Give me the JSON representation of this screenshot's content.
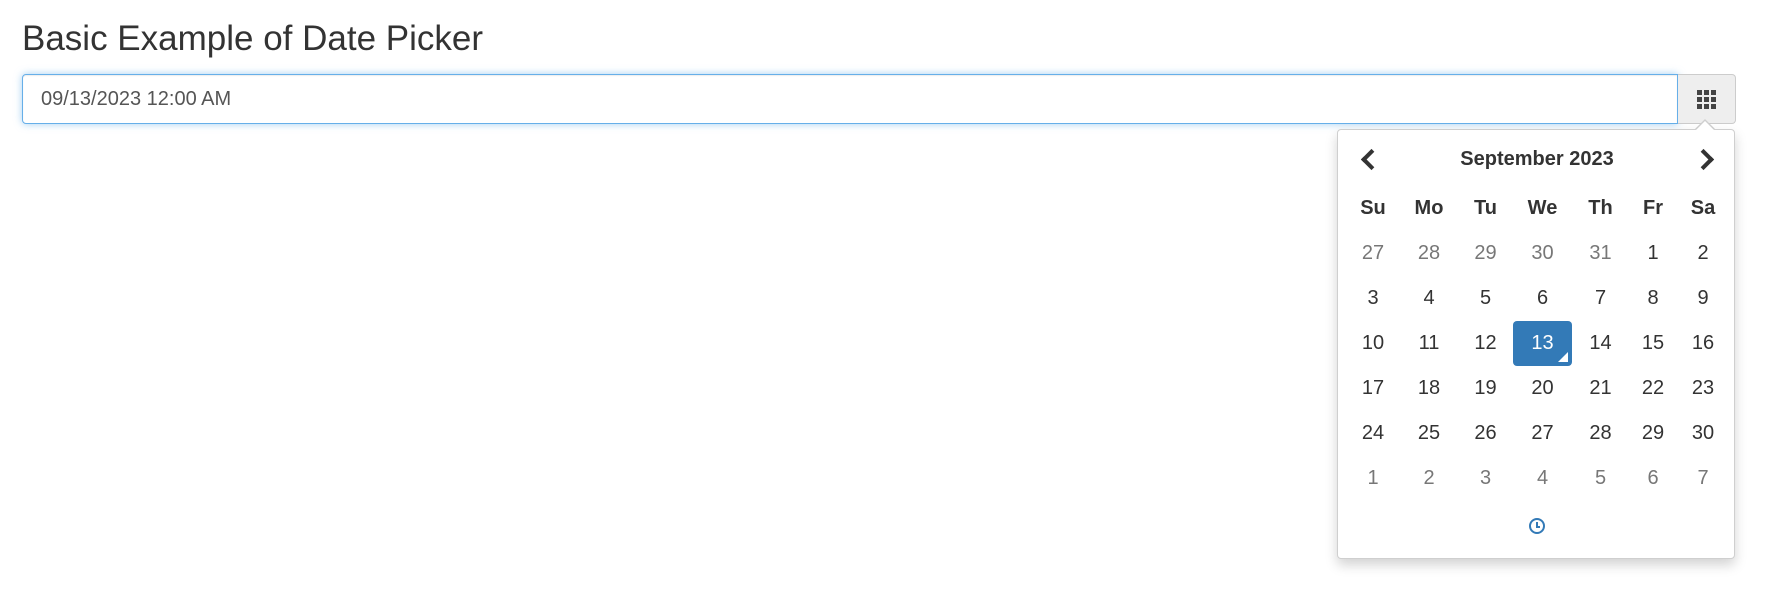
{
  "page": {
    "title": "Basic Example of Date Picker"
  },
  "date_input": {
    "value": "09/13/2023 12:00 AM"
  },
  "addon": {
    "icon": "grid-icon"
  },
  "picker": {
    "month_label": "September 2023",
    "prev_icon": "chevron-left-icon",
    "next_icon": "chevron-right-icon",
    "time_icon": "clock-icon",
    "accent_color": "#337ab7",
    "weekdays": [
      "Su",
      "Mo",
      "Tu",
      "We",
      "Th",
      "Fr",
      "Sa"
    ],
    "weeks": [
      [
        {
          "label": "27",
          "muted": true
        },
        {
          "label": "28",
          "muted": true
        },
        {
          "label": "29",
          "muted": true
        },
        {
          "label": "30",
          "muted": true
        },
        {
          "label": "31",
          "muted": true
        },
        {
          "label": "1"
        },
        {
          "label": "2"
        }
      ],
      [
        {
          "label": "3"
        },
        {
          "label": "4"
        },
        {
          "label": "5"
        },
        {
          "label": "6"
        },
        {
          "label": "7"
        },
        {
          "label": "8"
        },
        {
          "label": "9"
        }
      ],
      [
        {
          "label": "10"
        },
        {
          "label": "11"
        },
        {
          "label": "12"
        },
        {
          "label": "13",
          "selected": true
        },
        {
          "label": "14"
        },
        {
          "label": "15"
        },
        {
          "label": "16"
        }
      ],
      [
        {
          "label": "17"
        },
        {
          "label": "18"
        },
        {
          "label": "19"
        },
        {
          "label": "20"
        },
        {
          "label": "21"
        },
        {
          "label": "22"
        },
        {
          "label": "23"
        }
      ],
      [
        {
          "label": "24"
        },
        {
          "label": "25"
        },
        {
          "label": "26"
        },
        {
          "label": "27"
        },
        {
          "label": "28"
        },
        {
          "label": "29"
        },
        {
          "label": "30"
        }
      ],
      [
        {
          "label": "1",
          "muted": true
        },
        {
          "label": "2",
          "muted": true
        },
        {
          "label": "3",
          "muted": true
        },
        {
          "label": "4",
          "muted": true
        },
        {
          "label": "5",
          "muted": true
        },
        {
          "label": "6",
          "muted": true
        },
        {
          "label": "7",
          "muted": true
        }
      ]
    ]
  }
}
